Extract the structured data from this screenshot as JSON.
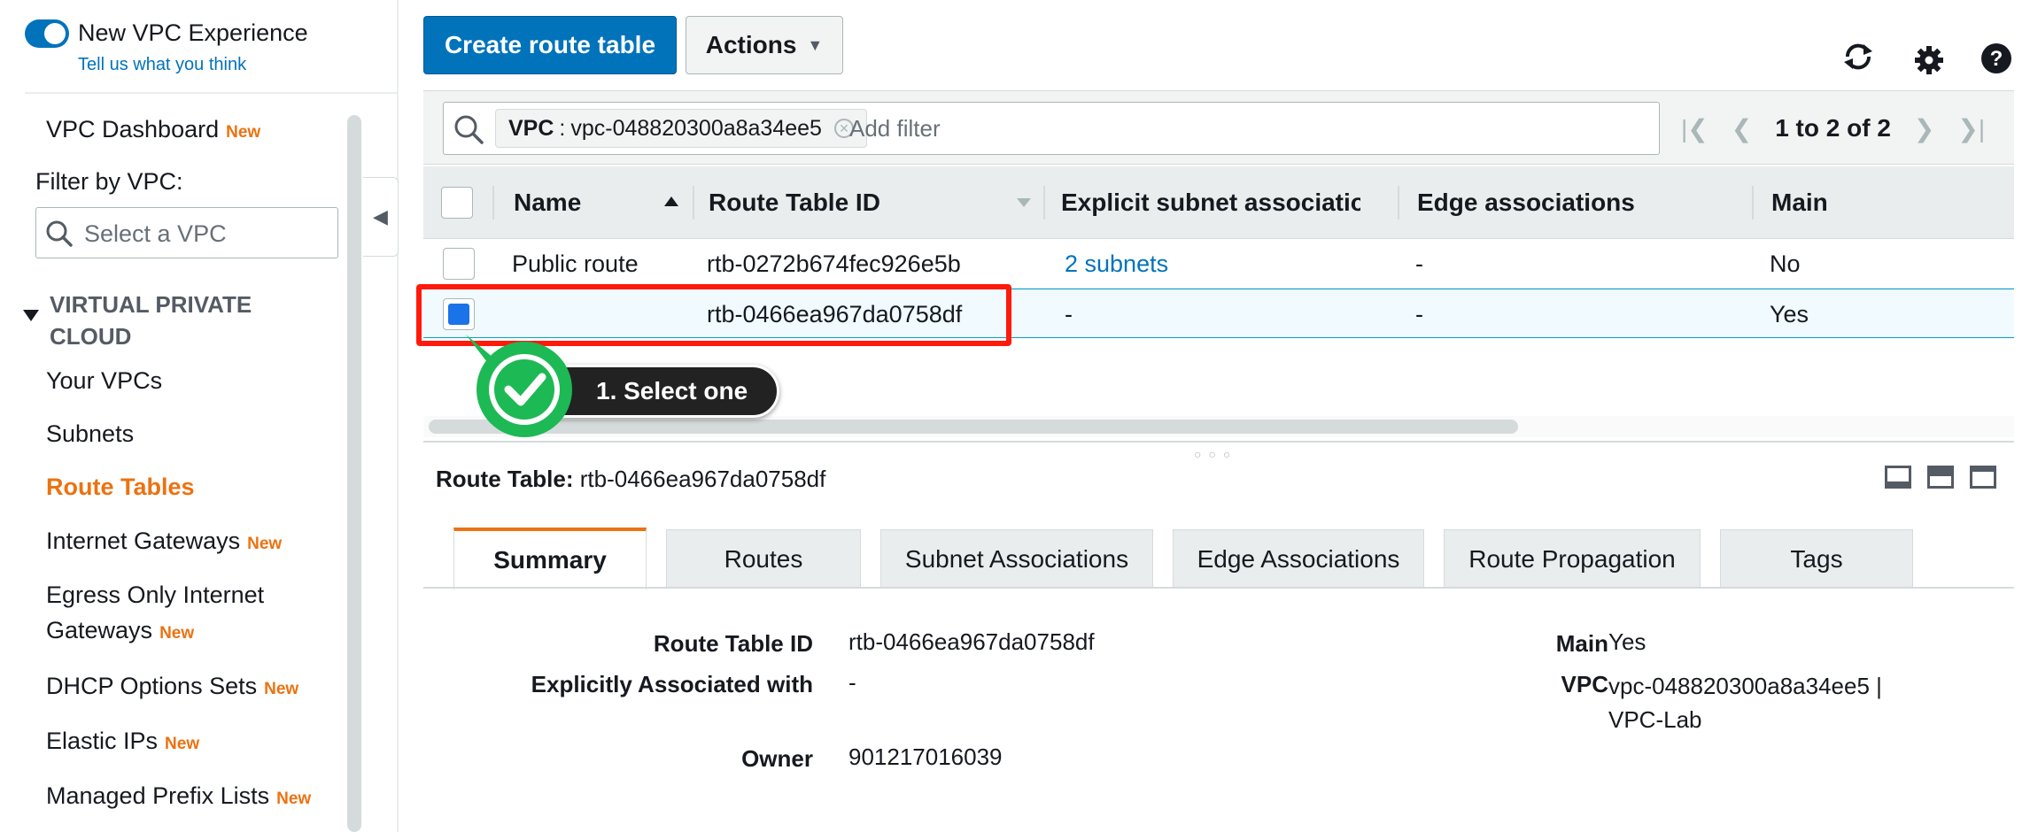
{
  "sidebar": {
    "experience_label": "New VPC Experience",
    "feedback_link": "Tell us what you think",
    "dashboard": "VPC Dashboard",
    "new_badge": "New",
    "filter_label": "Filter by VPC:",
    "vpc_select_placeholder": "Select a VPC",
    "section_title_line1": "VIRTUAL PRIVATE",
    "section_title_line2": "CLOUD",
    "items": [
      {
        "label": "Your VPCs"
      },
      {
        "label": "Subnets"
      },
      {
        "label": "Route Tables"
      },
      {
        "label": "Internet Gateways"
      },
      {
        "label": "Egress Only Internet"
      },
      {
        "label": "Gateways"
      },
      {
        "label": "DHCP Options Sets"
      },
      {
        "label": "Elastic IPs"
      },
      {
        "label": "Managed Prefix Lists"
      }
    ]
  },
  "toolbar": {
    "create_label": "Create route table",
    "actions_label": "Actions"
  },
  "filter": {
    "chip_key": "VPC",
    "chip_sep": ":",
    "chip_value": "vpc-048820300a8a34ee5",
    "add_filter_placeholder": "Add filter",
    "pager_text": "1 to 2 of 2"
  },
  "table": {
    "headers": [
      "Name",
      "Route Table ID",
      "Explicit subnet association",
      "Edge associations",
      "Main"
    ],
    "rows": [
      {
        "name": "Public route",
        "id": "rtb-0272b674fec926e5b",
        "subnets": "2 subnets",
        "edge": "-",
        "main": "No"
      },
      {
        "name": "",
        "id": "rtb-0466ea967da0758df",
        "subnets": "-",
        "edge": "-",
        "main": "Yes"
      }
    ]
  },
  "annotation": {
    "step_label": "1. Select one"
  },
  "detail": {
    "title_label": "Route Table:",
    "title_value": "rtb-0466ea967da0758df",
    "tabs": [
      "Summary",
      "Routes",
      "Subnet Associations",
      "Edge Associations",
      "Route Propagation",
      "Tags"
    ],
    "fields": {
      "route_table_id_label": "Route Table ID",
      "route_table_id_value": "rtb-0466ea967da0758df",
      "explicit_label": "Explicitly Associated with",
      "explicit_value": "-",
      "owner_label": "Owner",
      "owner_value": "901217016039",
      "main_label": "Main",
      "main_value": "Yes",
      "vpc_label": "VPC",
      "vpc_value_line1": "vpc-048820300a8a34ee5 |",
      "vpc_value_line2": "VPC-Lab"
    }
  },
  "colors": {
    "primary": "#0073bb",
    "accent": "#ec7211",
    "annotation_red": "#ff1a0c",
    "annotation_green": "#1db954"
  }
}
